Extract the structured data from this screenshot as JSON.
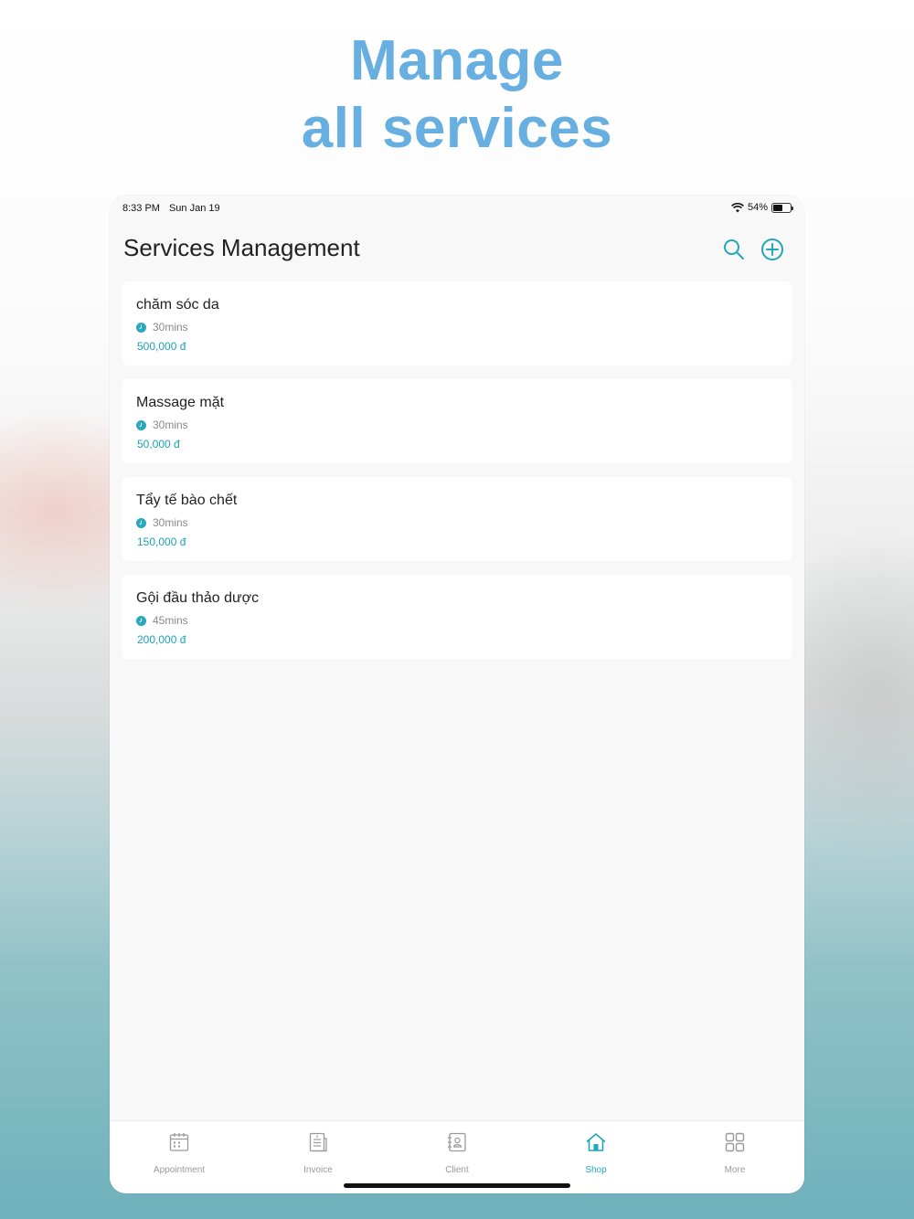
{
  "headline": {
    "line1": "Manage",
    "line2": "all services"
  },
  "status_bar": {
    "time": "8:33 PM",
    "date": "Sun Jan 19",
    "battery": "54%",
    "battery_level": 0.54
  },
  "header": {
    "title": "Services Management",
    "search_icon": "search-icon",
    "add_icon": "add-circle-icon"
  },
  "colors": {
    "accent": "#21a7bd",
    "headline": "#67afe0",
    "price": "#1aa3b8"
  },
  "services": [
    {
      "name": "chăm sóc da",
      "duration": "30mins",
      "price": "500,000 đ"
    },
    {
      "name": "Massage mặt",
      "duration": "30mins",
      "price": "50,000 đ"
    },
    {
      "name": "Tẩy tế bào chết",
      "duration": "30mins",
      "price": "150,000 đ"
    },
    {
      "name": "Gội đầu thảo dược",
      "duration": "45mins",
      "price": "200,000 đ"
    }
  ],
  "tabs": [
    {
      "label": "Appointment",
      "icon": "calendar-icon"
    },
    {
      "label": "Invoice",
      "icon": "invoice-icon"
    },
    {
      "label": "Client",
      "icon": "contacts-icon"
    },
    {
      "label": "Shop",
      "icon": "home-icon",
      "active": true
    },
    {
      "label": "More",
      "icon": "grid-icon"
    }
  ]
}
